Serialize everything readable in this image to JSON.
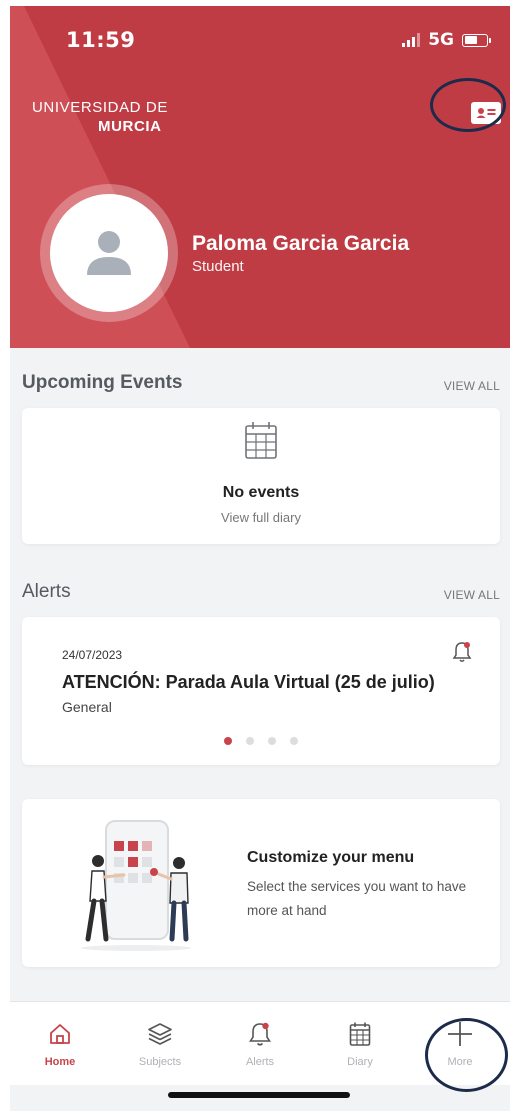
{
  "status_bar": {
    "time": "11:59",
    "network": "5G"
  },
  "header": {
    "logo_line1": "UNIVERSIDAD DE",
    "logo_line2": "MURCIA",
    "user_name": "Paloma Garcia Garcia",
    "user_role": "Student",
    "id_card_icon": "id-card-icon"
  },
  "upcoming_events": {
    "title": "Upcoming Events",
    "view_all": "VIEW ALL",
    "empty_title": "No events",
    "empty_link": "View full diary"
  },
  "alerts": {
    "title": "Alerts",
    "view_all": "VIEW ALL",
    "items": [
      {
        "date": "24/07/2023",
        "title": "ATENCIÓN: Parada Aula Virtual (25 de julio)",
        "category": "General"
      }
    ],
    "pager": {
      "count": 4,
      "active_index": 0
    }
  },
  "customize": {
    "title": "Customize your menu",
    "description": "Select the services you want to have more at hand"
  },
  "tabbar": {
    "items": [
      {
        "label": "Home",
        "icon": "home-icon",
        "active": true
      },
      {
        "label": "Subjects",
        "icon": "layers-icon",
        "active": false
      },
      {
        "label": "Alerts",
        "icon": "bell-icon",
        "active": false
      },
      {
        "label": "Diary",
        "icon": "calendar-icon",
        "active": false
      },
      {
        "label": "More",
        "icon": "plus-icon",
        "active": false
      }
    ]
  },
  "colors": {
    "brand": "#c8434b",
    "annotation": "#1d2b4a",
    "background": "#f2f3f5"
  }
}
